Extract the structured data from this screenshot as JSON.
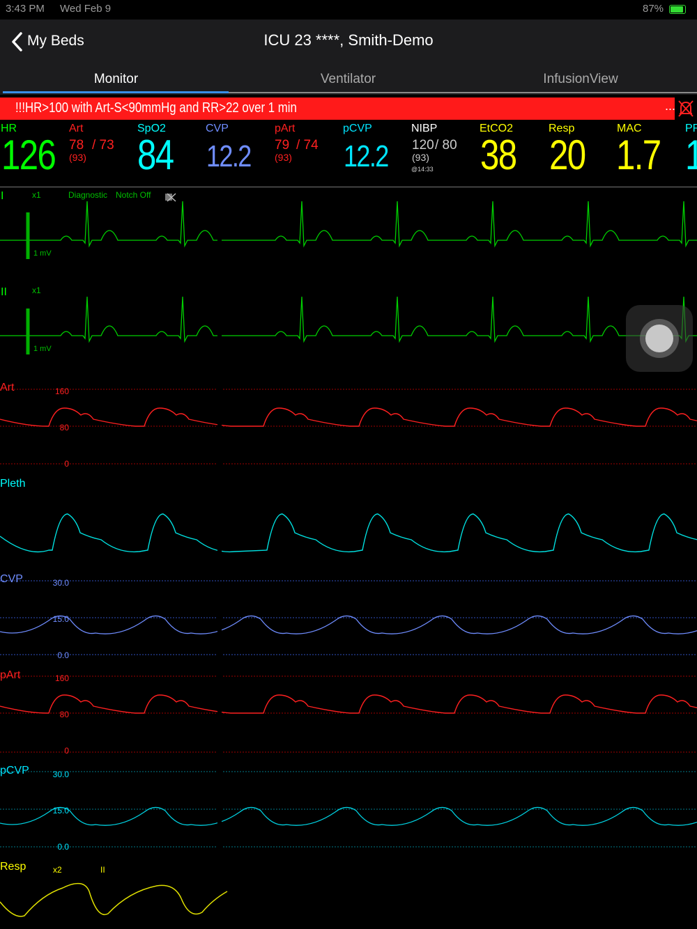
{
  "status": {
    "time": "3:43 PM",
    "date": "Wed Feb 9",
    "battery": "87%"
  },
  "nav": {
    "back_label": "My Beds",
    "title": "ICU 23 ****, Smith-Demo"
  },
  "tabs": [
    {
      "label": "Monitor"
    },
    {
      "label": "Ventilator"
    },
    {
      "label": "InfusionView"
    }
  ],
  "alarm": {
    "text": "!!!HR>100 with Art-S<90mmHg and RR>22 over 1 min",
    "more": "..."
  },
  "params": {
    "hr": {
      "label": "HR",
      "value": "126",
      "color": "#00ff00"
    },
    "art": {
      "label": "Art",
      "sys": "78",
      "dia": "/ 73",
      "mean": "(93)",
      "color": "#ff2020"
    },
    "spo2": {
      "label": "SpO2",
      "value": "84",
      "color": "#00ffff"
    },
    "cvp": {
      "label": "CVP",
      "value": "12.2",
      "color": "#6f8dff"
    },
    "part": {
      "label": "pArt",
      "sys": "79",
      "dia": "/ 74",
      "mean": "(93)",
      "color": "#ff2020"
    },
    "pcvp": {
      "label": "pCVP",
      "value": "12.2",
      "color": "#00e5ff"
    },
    "nibp": {
      "label": "NIBP",
      "sys": "120",
      "dia": "/ 80",
      "mean": "(93)",
      "time": "@14:33",
      "color": "#ffffff"
    },
    "etco2": {
      "label": "EtCO2",
      "value": "38",
      "color": "#ffff00"
    },
    "resp": {
      "label": "Resp",
      "value": "20",
      "color": "#ffff00"
    },
    "mac": {
      "label": "MAC",
      "value": "1.7",
      "color": "#ffff00"
    },
    "pr": {
      "label": "PR",
      "value": "1",
      "color": "#00ffff"
    }
  },
  "waves": {
    "ecg1": {
      "label": "I",
      "gain": "x1",
      "mode": "Diagnostic",
      "notch": "Notch Off",
      "cal": "1 mV",
      "icon": "pacer-off-icon"
    },
    "ecg2": {
      "label": "II",
      "gain": "x1",
      "cal": "1 mV"
    },
    "art": {
      "label": "Art",
      "scale": [
        "160",
        "80",
        "0"
      ]
    },
    "pleth": {
      "label": "Pleth"
    },
    "cvp": {
      "label": "CVP",
      "scale": [
        "30.0",
        "15.0",
        "0.0"
      ]
    },
    "part": {
      "label": "pArt",
      "scale": [
        "160",
        "80",
        "0"
      ]
    },
    "pcvp": {
      "label": "pCVP",
      "scale": [
        "30.0",
        "15.0",
        "0.0"
      ]
    },
    "resp": {
      "label": "Resp",
      "gain": "x2",
      "lead": "II"
    }
  }
}
